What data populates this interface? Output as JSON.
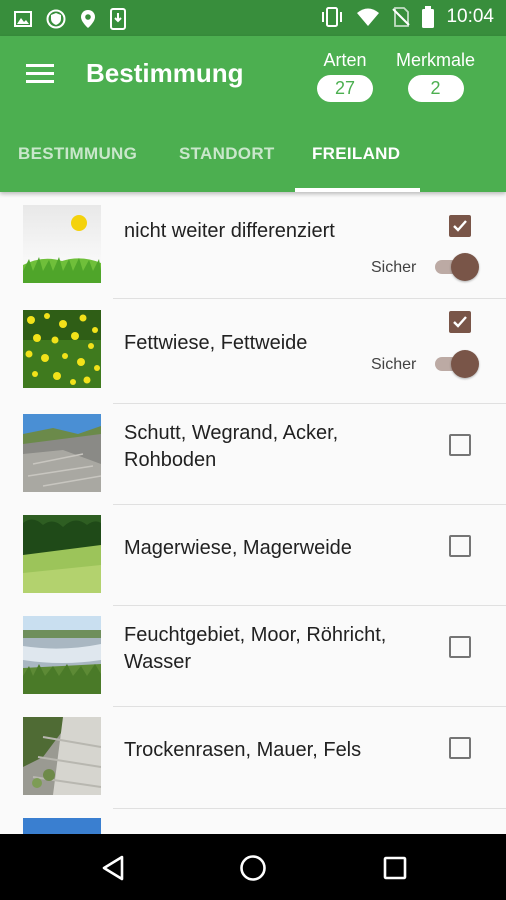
{
  "status_bar": {
    "time": "10:04",
    "left_icons": [
      "image-icon",
      "shield-icon",
      "location-pin-icon",
      "phone-download-icon"
    ],
    "right_icons": [
      "vibrate-icon",
      "wifi-icon",
      "no-sim-icon",
      "battery-icon"
    ]
  },
  "app_bar": {
    "title": "Bestimmung",
    "arten_label": "Arten",
    "arten_value": "27",
    "merkmale_label": "Merkmale",
    "merkmale_value": "2"
  },
  "tabs": [
    {
      "label": "BESTIMMUNG",
      "active": false
    },
    {
      "label": "STANDORT",
      "active": false
    },
    {
      "label": "FREILAND",
      "active": true
    }
  ],
  "items": [
    {
      "label": "nicht weiter differenziert",
      "checked": true,
      "sicher_label": "Sicher",
      "sicher_on": true
    },
    {
      "label": "Fettwiese, Fettweide",
      "checked": true,
      "sicher_label": "Sicher",
      "sicher_on": true
    },
    {
      "label": "Schutt, Wegrand, Acker, Rohboden",
      "checked": false
    },
    {
      "label": "Magerwiese, Magerweide",
      "checked": false
    },
    {
      "label": "Feuchtgebiet, Moor, Röhricht, Wasser",
      "checked": false
    },
    {
      "label": "Trockenrasen, Mauer, Fels",
      "checked": false
    }
  ],
  "colors": {
    "status_bar": "#388e3c",
    "app_bar": "#4caf50",
    "accent": "#795548",
    "switch_track": "#bcaaa4"
  },
  "nav_bar": {
    "icons": [
      "back-icon",
      "home-icon",
      "recents-icon"
    ]
  }
}
